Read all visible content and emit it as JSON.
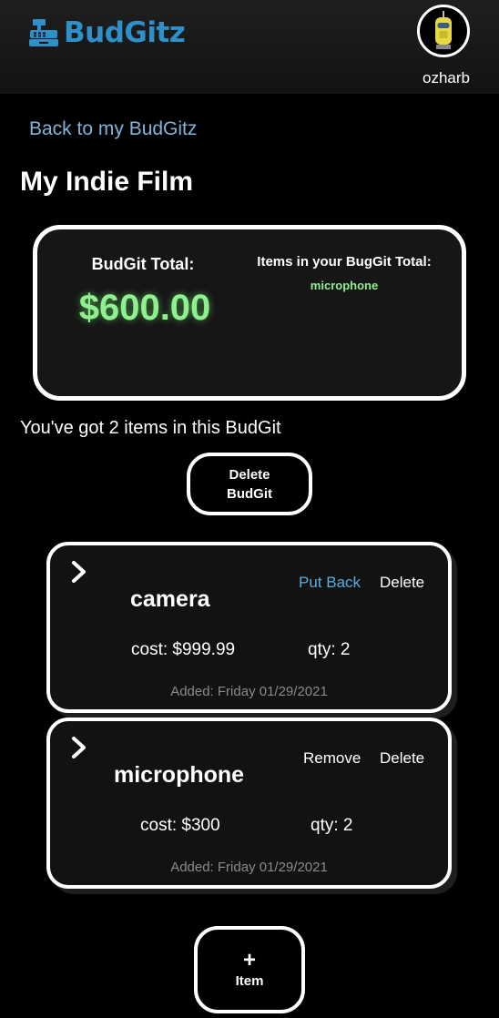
{
  "header": {
    "app_name": "BudGitz",
    "username": "ozharb"
  },
  "nav": {
    "back_label": "Back to my BudGitz"
  },
  "budgit": {
    "title": "My Indie Film"
  },
  "summary": {
    "total_label": "BudGit Total:",
    "total_value": "$600.00",
    "items_label": "Items in your BugGit Total:",
    "items": [
      "microphone"
    ]
  },
  "count_text": "You've got 2 items in this BudGit",
  "delete_budgit_label": "Delete BudGit",
  "items": [
    {
      "name": "camera",
      "primary_action": "Put Back",
      "secondary_action": "Delete",
      "cost": "cost: $999.99",
      "qty": "qty: 2",
      "added": "Added: Friday 01/29/2021"
    },
    {
      "name": "microphone",
      "primary_action": "Remove",
      "secondary_action": "Delete",
      "cost": "cost: $300",
      "qty": "qty: 2",
      "added": "Added: Friday 01/29/2021"
    }
  ],
  "add_item": {
    "plus": "+",
    "label": "Item"
  },
  "colors": {
    "brand": "#2f8fc8",
    "total_green": "#8ff08f",
    "link": "#7fb4dc",
    "put_back": "#5aaede"
  }
}
